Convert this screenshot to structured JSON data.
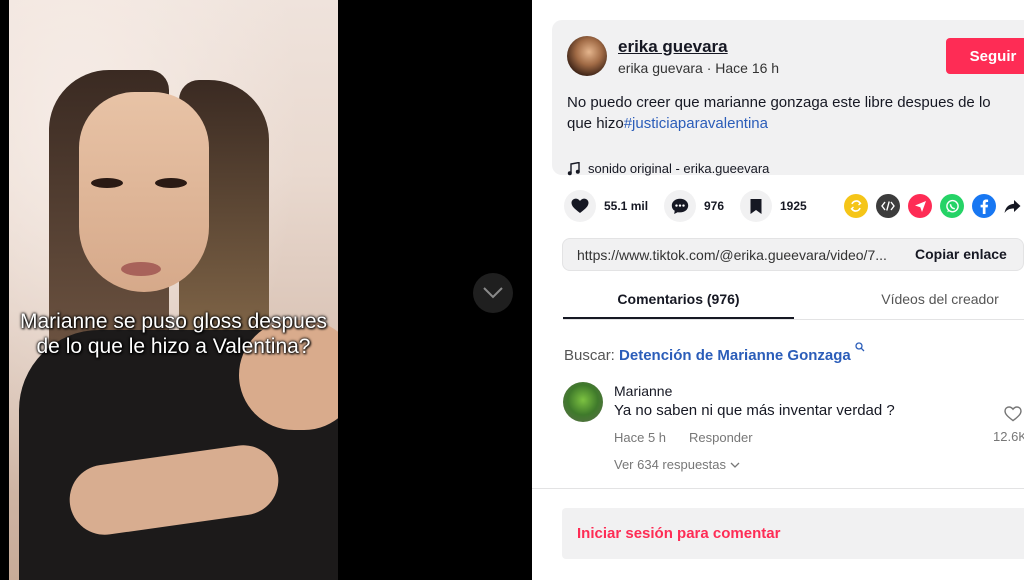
{
  "video": {
    "caption": "Marianne se puso gloss despues de lo que le hizo a Valentina?"
  },
  "post": {
    "author_name": "erika guevara",
    "author_meta": "erika guevara · Hace 16 h",
    "follow_label": "Seguir",
    "description": "No puedo creer que marianne gonzaga este libre despues de lo que hizo",
    "hashtag": "#justiciaparavalentina",
    "sound": "sonido original - erika.gueevara"
  },
  "actions": {
    "likes": "55.1 mil",
    "comments": "976",
    "saves": "1925"
  },
  "share_colors": {
    "repost": "#f5c518",
    "embed": "#3c3c3c",
    "send": "#fe2c55",
    "whatsapp": "#25d366",
    "facebook": "#1877f2"
  },
  "link": {
    "url": "https://www.tiktok.com/@erika.gueevara/video/7...",
    "copy_label": "Copiar enlace"
  },
  "tabs": {
    "comments": "Comentarios (976)",
    "creator_videos": "Vídeos del creador"
  },
  "search": {
    "prefix": "Buscar:",
    "query": "Detención de Marianne Gonzaga"
  },
  "comment": {
    "user": "Marianne",
    "text": "Ya no saben ni que más inventar verdad ?",
    "time": "Hace 5 h",
    "reply_label": "Responder",
    "replies_label": "Ver 634 respuestas",
    "likes": "12.6K"
  },
  "login": {
    "label": "Iniciar sesión para comentar"
  }
}
